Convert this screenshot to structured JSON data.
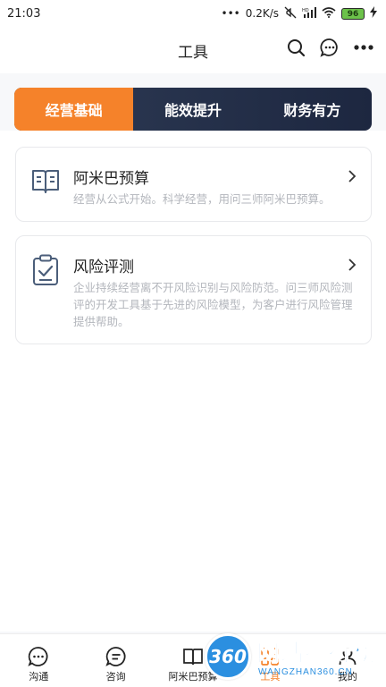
{
  "status_bar": {
    "time": "21:03",
    "network_speed": "0.2K/s",
    "signal_label": "HD",
    "battery": "96"
  },
  "header": {
    "title": "工具",
    "icons": [
      "search-icon",
      "chat-bubble-icon",
      "more-icon"
    ]
  },
  "tabs": [
    {
      "label": "经营基础",
      "active": true
    },
    {
      "label": "能效提升",
      "active": false
    },
    {
      "label": "财务有方",
      "active": false
    }
  ],
  "cards": [
    {
      "title": "阿米巴预算",
      "description": "经营从公式开始。科学经营，用问三师阿米巴预算。",
      "icon": "book-icon"
    },
    {
      "title": "风险评测",
      "description": "企业持续经营离不开风险识别与风险防范。问三师风险测评的开发工具基于先进的风险模型，为客户进行风险管理提供帮助。",
      "icon": "clipboard-check-icon"
    }
  ],
  "bottom_nav": [
    {
      "label": "沟通",
      "icon": "chat-icon"
    },
    {
      "label": "咨询",
      "icon": "consult-icon"
    },
    {
      "label": "阿米巴预算",
      "icon": "book-icon"
    },
    {
      "label": "工具",
      "icon": "tools-icon",
      "active": true
    },
    {
      "label": "我的",
      "icon": "user-icon"
    }
  ],
  "watermark": {
    "badge": "360",
    "text": "网站排行榜",
    "sub": "WANGZHAN360.CN"
  },
  "colors": {
    "accent": "#f5822a",
    "tab_bar": "#2e3b55",
    "watermark_blue": "#2b8fe0"
  }
}
